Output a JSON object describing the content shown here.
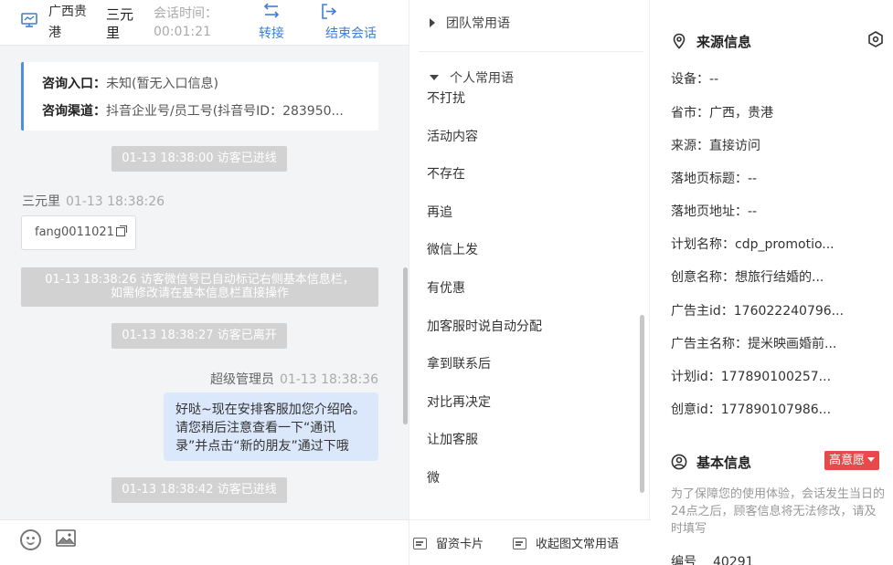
{
  "header": {
    "location": "广西贵港",
    "visitor_name": "三元里",
    "time_label": "会话时间：",
    "time_value": "00:01:21",
    "transfer_label": "转接",
    "end_label": "结束会话"
  },
  "inquiry": {
    "entry_label": "咨询入口：",
    "entry_value": "未知(暂无入口信息)",
    "channel_label": "咨询渠道：",
    "channel_value": "抖音企业号/员工号(抖音号ID：283950..."
  },
  "messages": {
    "sys1": "01-13 18:38:00 访客已进线",
    "visitor_name": "三元里",
    "visitor_time": "01-13 18:38:26",
    "visitor_text": "fang0011021",
    "sys2_line1": "01-13 18:38:26 访客微信号已自动标记右侧基本信息栏，",
    "sys2_line2": "如需修改请在基本信息栏直接操作",
    "sys3": "01-13 18:38:27 访客已离开",
    "agent_name": "超级管理员",
    "agent_time": "01-13 18:38:36",
    "agent_text": "好哒~现在安排客服加您介绍哈。请您稍后注意查看一下“通讯录”并点击“新的朋友”通过下哦",
    "sys4": "01-13 18:38:42 访客已进线"
  },
  "phrases": {
    "team_group": "团队常用语",
    "personal_group": "个人常用语",
    "items": [
      "不打扰",
      "活动内容",
      "不存在",
      "再追",
      "微信上发",
      "有优惠",
      "加客服时说自动分配",
      "拿到联系后",
      "对比再决定",
      "让加客服",
      "微"
    ],
    "footer_card": "留资卡片",
    "footer_collapse": "收起图文常用语"
  },
  "source_info": {
    "title": "来源信息",
    "rows": [
      "设备：--",
      "省市：广西，贵港",
      "来源：直接访问",
      "落地页标题：--",
      "落地页地址：--",
      "计划名称：cdp_promotio...",
      "创意名称：想旅行结婚的...",
      "广告主id：176022240796...",
      "广告主名称：提米映画婚前...",
      "计划id：177890100257...",
      "创意id：177890107986..."
    ]
  },
  "basic_info": {
    "title": "基本信息",
    "badge": "高意愿",
    "note": "为了保障您的使用体验，会话发生当日的24点之后，顾客信息将无法修改，请及时填写",
    "id_label": "编号",
    "id_value": "40291"
  },
  "colors": {
    "accent": "#3c7ed8",
    "badge_red": "#e64a4a",
    "agent_bubble": "#dbe7fb",
    "system_msg": "#d2d2d2"
  }
}
